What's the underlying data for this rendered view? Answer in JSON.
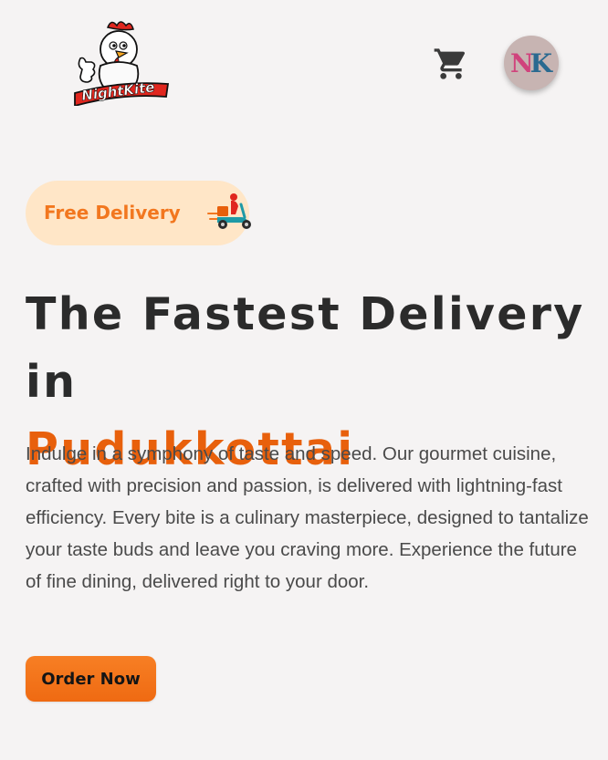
{
  "header": {
    "logo_text": "NightKite",
    "cart_icon": "shopping-cart-icon",
    "avatar_initials_1": "N",
    "avatar_initials_2": "K"
  },
  "badge": {
    "label": "Free Delivery",
    "icon": "delivery-scooter-icon"
  },
  "hero": {
    "title_line1": "The Fastest Delivery in",
    "title_line2": "Pudukkottai",
    "description": "Indulge in a symphony of taste and speed. Our gourmet cuisine, crafted with precision and passion, is delivered with lightning-fast efficiency. Every bite is a culinary masterpiece, designed to tantalize your taste buds and leave you craving more. Experience the future of fine dining, delivered right to your door."
  },
  "cta": {
    "label": "Order Now"
  },
  "colors": {
    "background": "#f5f3f3",
    "accent": "#e8600c",
    "badge_bg": "#ffe6c7",
    "badge_text": "#f2771f",
    "button": "#f77f24"
  }
}
